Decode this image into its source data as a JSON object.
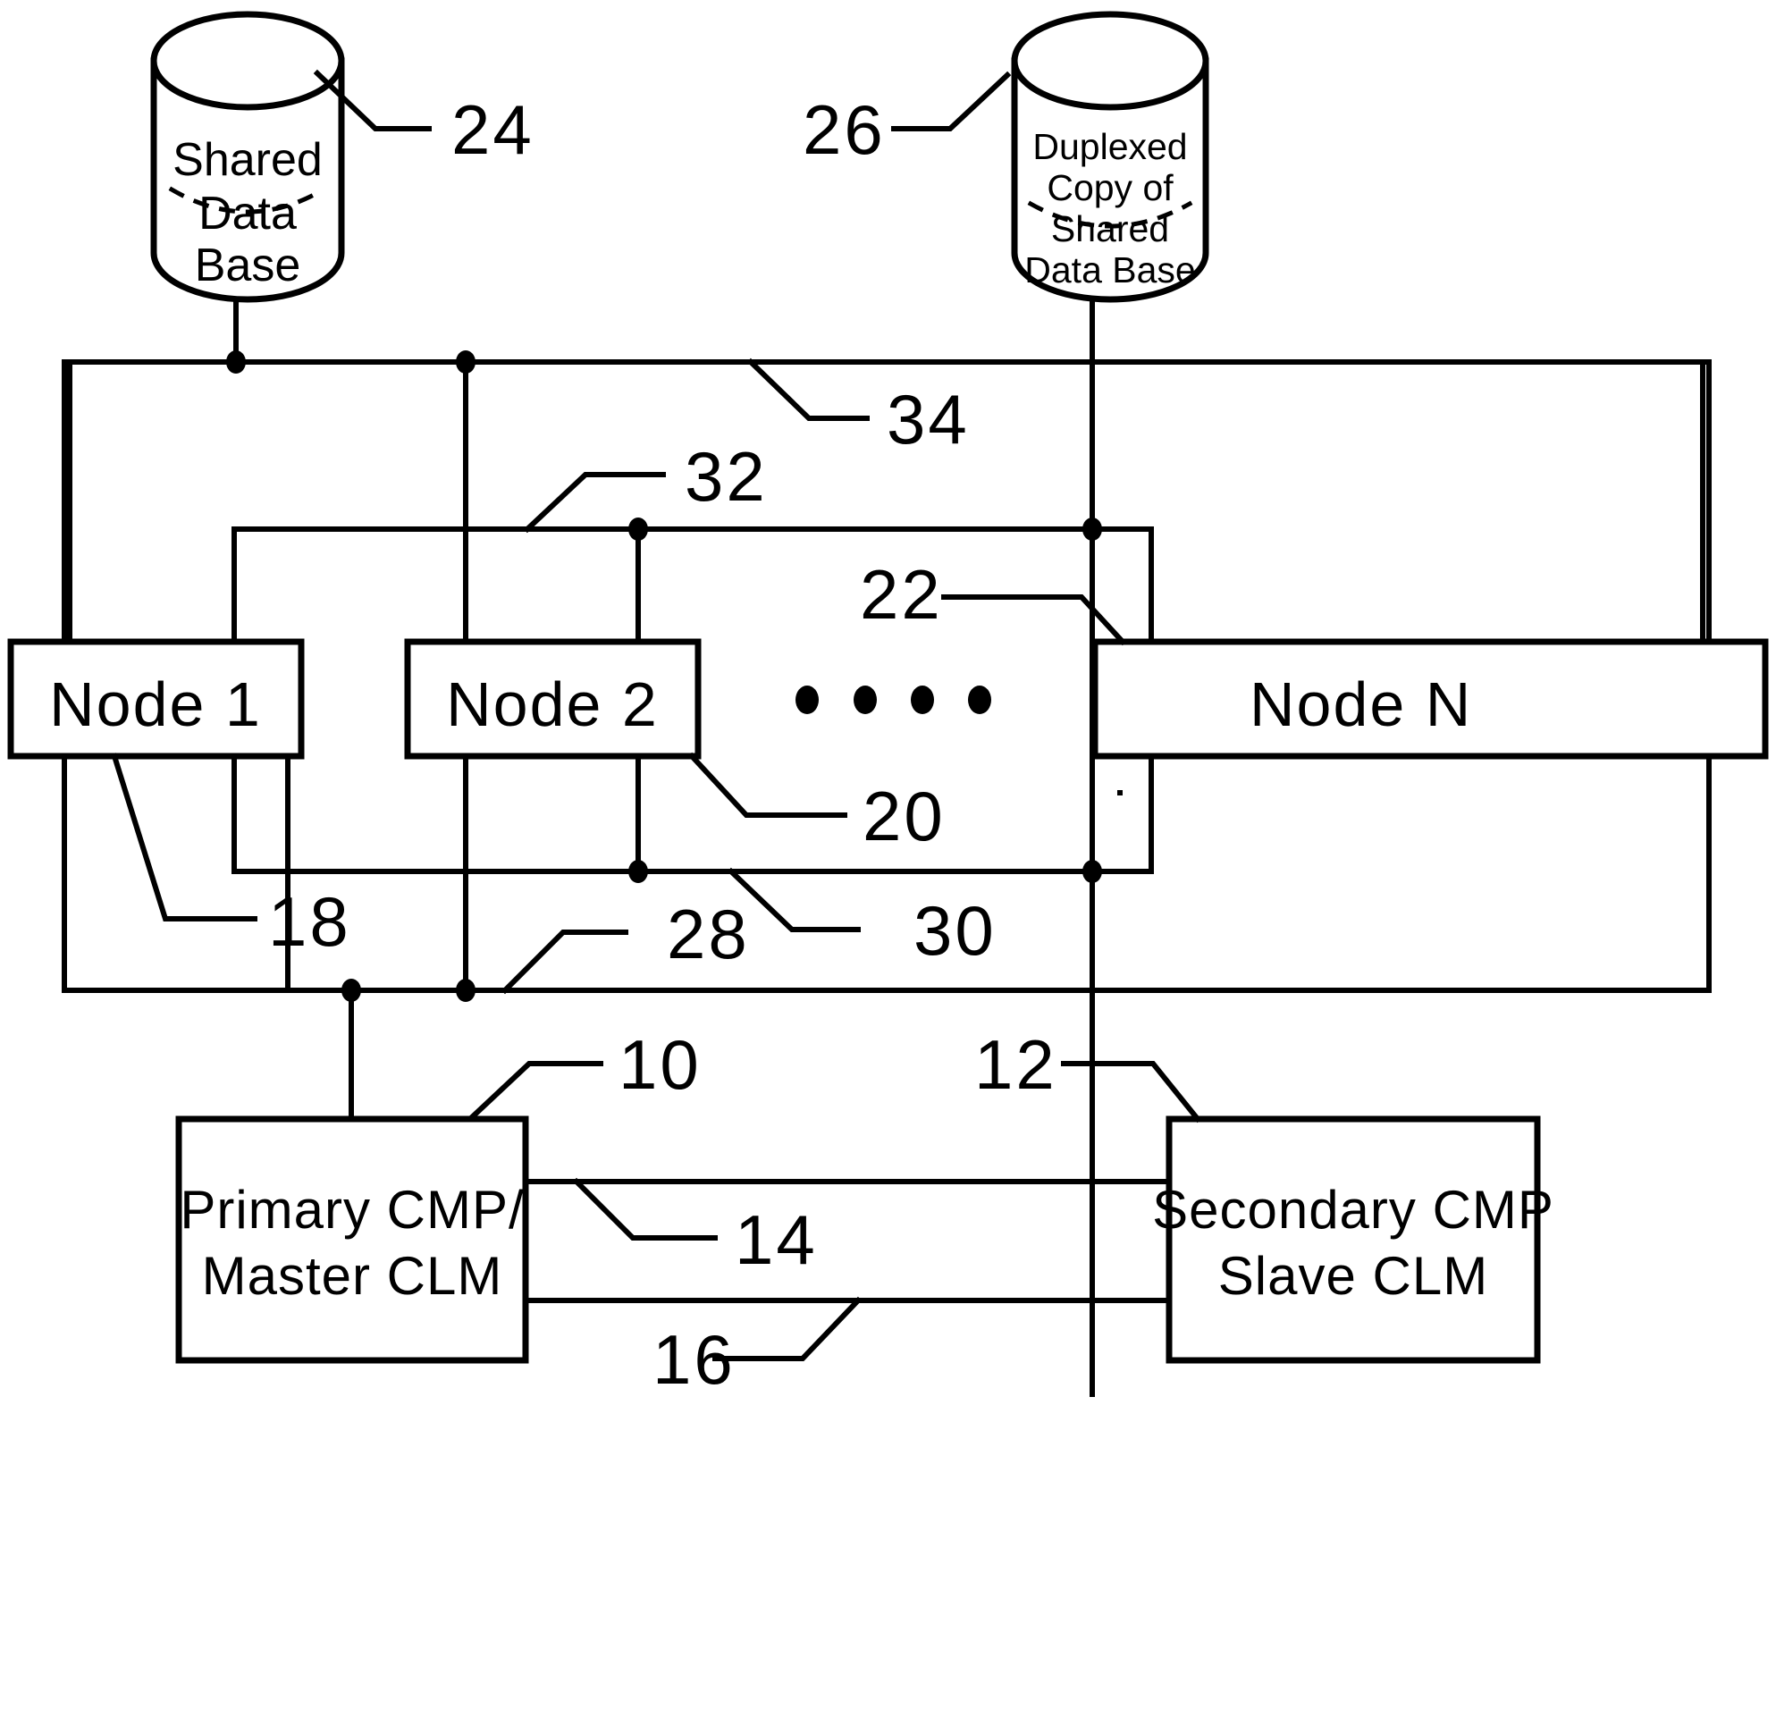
{
  "figure": {
    "title": "Distributed database node cluster block diagram",
    "line_color": "#000000",
    "background_color": "#ffffff"
  },
  "databases": [
    {
      "id": "shared-db",
      "lines": [
        "Shared",
        "Data",
        "Base"
      ],
      "reference": "24"
    },
    {
      "id": "duplexed-db",
      "lines": [
        "Duplexed",
        "Copy of",
        "Shared",
        "Data Base"
      ],
      "reference": "26"
    }
  ],
  "nodes": [
    {
      "id": "node-1",
      "label": "Node 1"
    },
    {
      "id": "node-2",
      "label": "Node 2"
    },
    {
      "id": "node-n",
      "label": "Node N"
    }
  ],
  "ellipsis": {
    "dot_count": 4
  },
  "processors": [
    {
      "id": "primary-cmp",
      "lines": [
        "Primary CMP/",
        "Master CLM"
      ],
      "reference": "10"
    },
    {
      "id": "secondary-cmp",
      "lines": [
        "Secondary CMP",
        "Slave CLM"
      ],
      "reference": "12"
    }
  ],
  "references": {
    "r10": "10",
    "r12": "12",
    "r14": "14",
    "r16": "16",
    "r18": "18",
    "r20": "20",
    "r22": "22",
    "r24": "24",
    "r26": "26",
    "r28": "28",
    "r30": "30",
    "r32": "32",
    "r34": "34"
  },
  "buses": [
    {
      "id": "bus-34",
      "reference": "34"
    },
    {
      "id": "bus-32",
      "reference": "32"
    },
    {
      "id": "bus-30",
      "reference": "30"
    },
    {
      "id": "bus-28",
      "reference": "28"
    },
    {
      "id": "link-14",
      "reference": "14"
    },
    {
      "id": "link-16",
      "reference": "16"
    },
    {
      "id": "link-18",
      "reference": "18"
    },
    {
      "id": "link-20",
      "reference": "20"
    }
  ]
}
